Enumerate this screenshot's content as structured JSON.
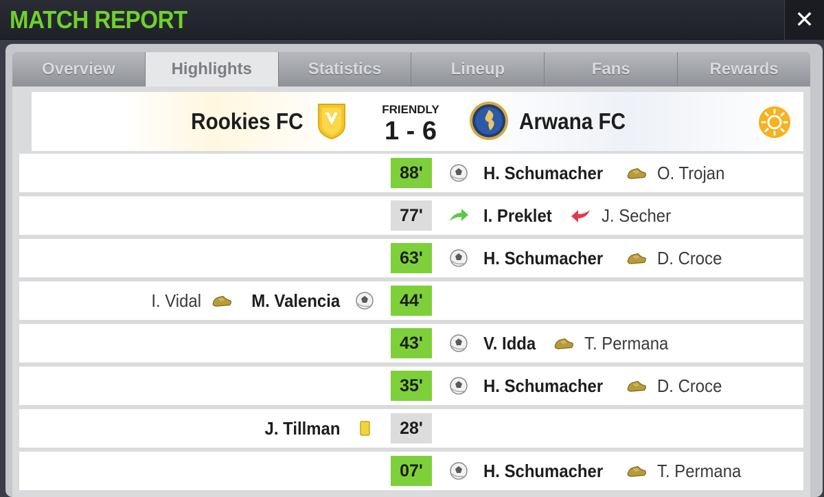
{
  "header": {
    "title": "MATCH REPORT",
    "close_label": "✕"
  },
  "tabs": [
    {
      "label": "Overview",
      "active": false
    },
    {
      "label": "Highlights",
      "active": true
    },
    {
      "label": "Statistics",
      "active": false
    },
    {
      "label": "Lineup",
      "active": false
    },
    {
      "label": "Fans",
      "active": false
    },
    {
      "label": "Rewards",
      "active": false
    }
  ],
  "match": {
    "home_team": "Rookies FC",
    "away_team": "Arwana FC",
    "type": "FRIENDLY",
    "score": "1 - 6",
    "weather": "sun-icon"
  },
  "colors": {
    "title_green": "#6fd22a",
    "minute_green": "#7ed03a",
    "minute_grey": "#dcdcdc",
    "yellow_card": "#f2d33a"
  },
  "events": [
    {
      "minute": "88'",
      "side": "away",
      "type": "goal",
      "player": "H. Schumacher",
      "secondary_type": "assist",
      "secondary": "O. Trojan",
      "minute_style": "green"
    },
    {
      "minute": "77'",
      "side": "away",
      "type": "substitution",
      "player": "I. Preklet",
      "secondary_type": "sub-out",
      "secondary": "J. Secher",
      "minute_style": "grey"
    },
    {
      "minute": "63'",
      "side": "away",
      "type": "goal",
      "player": "H. Schumacher",
      "secondary_type": "assist",
      "secondary": "D. Croce",
      "minute_style": "green"
    },
    {
      "minute": "44'",
      "side": "home",
      "type": "goal",
      "player": "M. Valencia",
      "secondary_type": "assist",
      "secondary": "I. Vidal",
      "minute_style": "green"
    },
    {
      "minute": "43'",
      "side": "away",
      "type": "goal",
      "player": "V. Idda",
      "secondary_type": "assist",
      "secondary": "T. Permana",
      "minute_style": "green"
    },
    {
      "minute": "35'",
      "side": "away",
      "type": "goal",
      "player": "H. Schumacher",
      "secondary_type": "assist",
      "secondary": "D. Croce",
      "minute_style": "green"
    },
    {
      "minute": "28'",
      "side": "home",
      "type": "yellow-card",
      "player": "J. Tillman",
      "secondary_type": "",
      "secondary": "",
      "minute_style": "grey"
    },
    {
      "minute": "07'",
      "side": "away",
      "type": "goal",
      "player": "H. Schumacher",
      "secondary_type": "assist",
      "secondary": "T. Permana",
      "minute_style": "green"
    }
  ]
}
